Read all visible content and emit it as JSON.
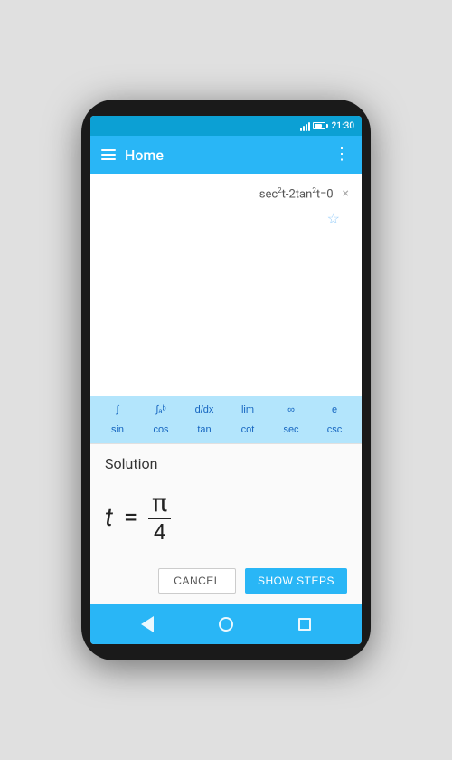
{
  "status": {
    "time": "21:30"
  },
  "appbar": {
    "title": "Home",
    "menu_label": "⋮"
  },
  "history": {
    "expression": "sec²t-2tan²t=0",
    "close_label": "×"
  },
  "keyboard": {
    "row1": [
      "∫",
      "∫ₐᵇ",
      "d/dx",
      "lim",
      "∞",
      "e"
    ],
    "row2": [
      "sin",
      "cos",
      "tan",
      "cot",
      "sec",
      "csc"
    ]
  },
  "solution": {
    "label": "Solution",
    "variable": "t",
    "equals": "=",
    "numerator": "π",
    "denominator": "4"
  },
  "buttons": {
    "cancel": "Cancel",
    "show_steps": "Show steps"
  },
  "navbar": {
    "back": "◁",
    "home": "○",
    "recent": "□"
  }
}
